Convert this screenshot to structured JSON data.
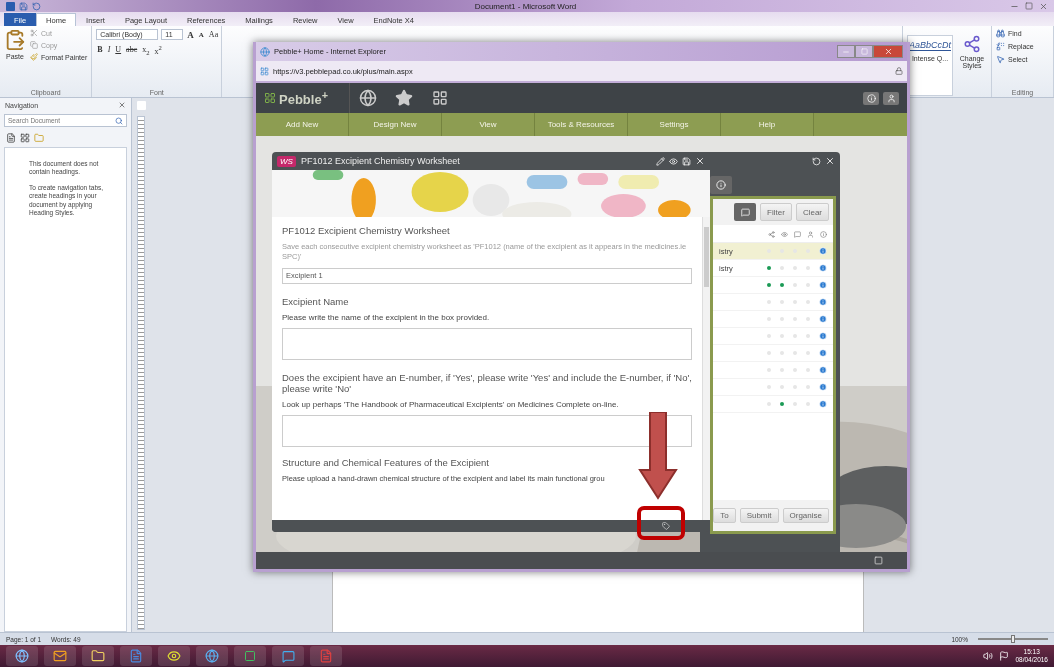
{
  "word": {
    "title": "Document1 - Microsoft Word",
    "ribbon_tabs": [
      {
        "label": "File",
        "selected": false,
        "kind": "file"
      },
      {
        "label": "Home",
        "selected": true,
        "kind": "tab"
      },
      {
        "label": "Insert",
        "selected": false,
        "kind": "tab"
      },
      {
        "label": "Page Layout",
        "selected": false,
        "kind": "tab"
      },
      {
        "label": "References",
        "selected": false,
        "kind": "tab"
      },
      {
        "label": "Mailings",
        "selected": false,
        "kind": "tab"
      },
      {
        "label": "Review",
        "selected": false,
        "kind": "tab"
      },
      {
        "label": "View",
        "selected": false,
        "kind": "tab"
      },
      {
        "label": "EndNote X4",
        "selected": false,
        "kind": "tab"
      }
    ],
    "clipboard": {
      "paste": "Paste",
      "cut": "Cut",
      "copy": "Copy",
      "format_painter": "Format Painter",
      "label": "Clipboard"
    },
    "font": {
      "name": "Calibri (Body)",
      "size": "11",
      "size_buttons": [
        "A",
        "A"
      ],
      "case_button": "Aa",
      "format_buttons": [
        "B",
        "I",
        "U",
        "abc",
        "x$_{2}$",
        "x$^{2}$"
      ],
      "label": "Font"
    },
    "styles": {
      "preview": "AaBbCcDt",
      "name": "Intense Q...",
      "change": "Change Styles"
    },
    "editing": {
      "items": [
        "Find",
        "Replace",
        "Select"
      ],
      "label": "Editing"
    },
    "navigation": {
      "title": "Navigation",
      "placeholder": "Search Document",
      "messages": [
        "This document does not contain headings.",
        "To create navigation tabs, create headings in your document by applying Heading Styles."
      ]
    },
    "status_bar": {
      "page": "Page: 1 of 1",
      "words": "Words: 49",
      "zoom": "100%",
      "level": 0.5
    }
  },
  "browser": {
    "title": "Pebble+ Home - Internet Explorer",
    "url": "https://v3.pebblepad.co.uk/plus/main.aspx"
  },
  "pebble": {
    "logo": "Pebble$^{+}$",
    "menu": [
      "Add New",
      "Design New",
      "View",
      "Tools & Resources",
      "Settings",
      "Help"
    ],
    "worksheet": {
      "badge": "WS",
      "title": "PF1012 Excipient Chemistry Worksheet",
      "heading": "PF1012 Excipient Chemistry Worksheet",
      "hint": "Save each consecutive excipient chemistry worksheet as 'PF1012 (name of the excipient as it appears in the medicines.ie SPC)'",
      "value": "Excipient 1",
      "questions": [
        {
          "title": "Excipient Name",
          "instruction": "Please write the name of the excipient in the box provided."
        },
        {
          "title": "Does the excipient have an E-number, if 'Yes', please write 'Yes' and include the E-number, if 'No', please write 'No'",
          "instruction": "Look up perhaps 'The Handbook of Pharmaceutical Excipients' on Medicines Complete on-line."
        }
      ],
      "section": "Structure and Chemical Features of the Excipient",
      "section_text": "Please upload a hand-drawn chemical structure of the excipient and label its main functional grou"
    },
    "assets": {
      "filter": "Filter",
      "clear": "Clear",
      "rows": [
        {
          "name": "istry",
          "selected": true,
          "dots": [
            false,
            false,
            false,
            false
          ]
        },
        {
          "name": "istry",
          "selected": false,
          "dots": [
            true,
            false,
            false,
            false
          ]
        },
        {
          "selected": false,
          "dots": [
            true,
            true,
            false,
            false
          ]
        },
        {
          "selected": false,
          "dots": [
            false,
            false,
            false,
            false
          ]
        },
        {
          "selected": false,
          "dots": [
            false,
            false,
            false,
            false
          ]
        },
        {
          "selected": false,
          "dots": [
            false,
            false,
            false,
            false
          ]
        },
        {
          "selected": false,
          "dots": [
            false,
            false,
            false,
            false
          ]
        },
        {
          "selected": false,
          "dots": [
            false,
            false,
            false,
            false
          ]
        },
        {
          "selected": false,
          "dots": [
            false,
            false,
            false,
            false
          ]
        },
        {
          "selected": false,
          "dots": [
            false,
            true,
            false,
            false
          ]
        }
      ],
      "buttons": [
        "To",
        "Submit",
        "Organise"
      ]
    }
  },
  "taskbar": {
    "time": "15:13",
    "date": "08/04/2016"
  }
}
